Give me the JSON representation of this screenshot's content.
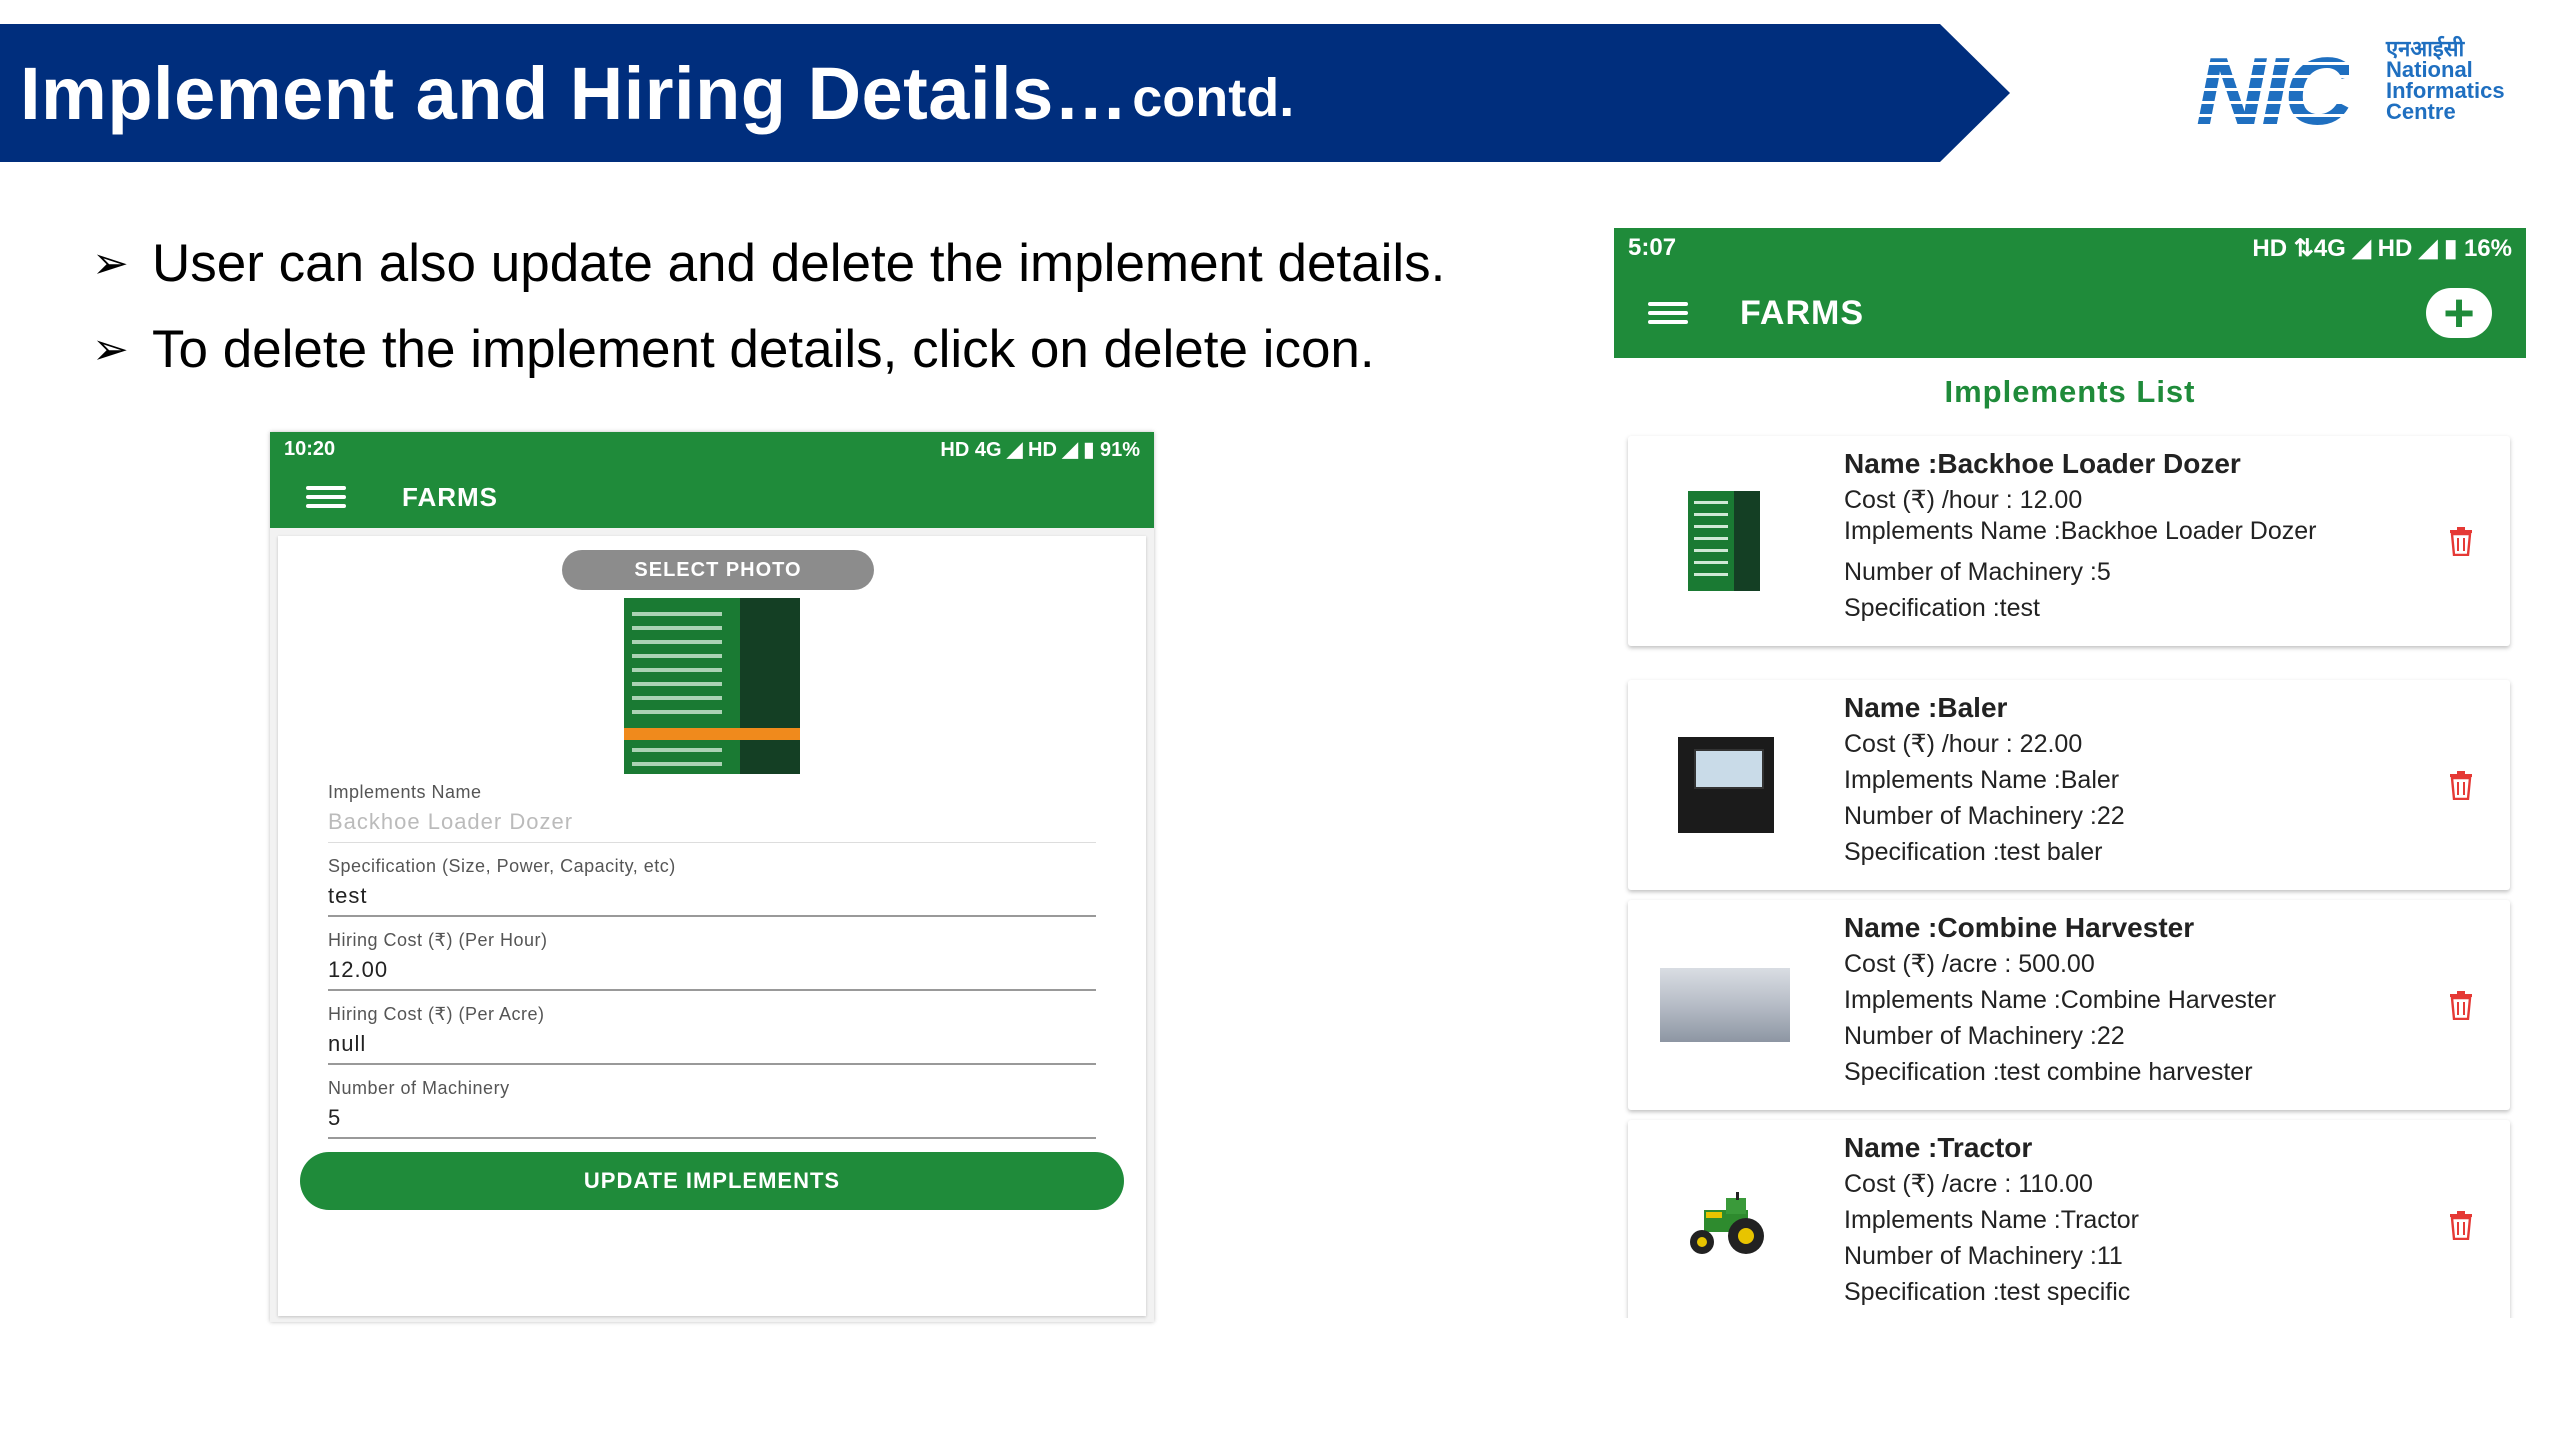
{
  "slide": {
    "title_main": "Implement and Hiring Details…",
    "title_suffix": "contd.",
    "logo": {
      "letters": "NIC",
      "hindi": "एनआईसी",
      "line1": "National",
      "line2": "Informatics",
      "line3": "Centre"
    },
    "bullets": [
      "User can also update and delete the implement details.",
      "To delete the implement details, click on delete icon."
    ],
    "bullet_symbol": "➢"
  },
  "left_phone": {
    "status_time": "10:20",
    "status_right": "HD 4G ◢ HD ◢ ▮ 91%",
    "app_title": "FARMS",
    "select_photo": "SELECT PHOTO",
    "fields": [
      {
        "label": "Implements Name",
        "value": "Backhoe Loader Dozer"
      },
      {
        "label": "Specification (Size, Power, Capacity, etc)",
        "value": "test"
      },
      {
        "label": "Hiring Cost (₹) (Per Hour)",
        "value": "12.00"
      },
      {
        "label": "Hiring Cost (₹) (Per Acre)",
        "value": "null"
      },
      {
        "label": "Number of Machinery",
        "value": "5"
      }
    ],
    "update_button": "UPDATE IMPLEMENTS"
  },
  "right_phone": {
    "status_time": "5:07",
    "status_right": "HD ⇅4G ◢ HD ◢ ▮ 16%",
    "app_title": "FARMS",
    "add_icon": "+",
    "list_title": "Implements List",
    "items": [
      {
        "name": "Name  :Backhoe Loader Dozer",
        "cost": "Cost (₹) /hour : 12.00",
        "implements_name": "Implements Name  :Backhoe Loader Dozer",
        "machinery": "Number of Machinery :5",
        "specification": "Specification  :test"
      },
      {
        "name": "Name  :Baler",
        "cost": "Cost (₹) /hour : 22.00",
        "implements_name": "Implements Name  :Baler",
        "machinery": "Number of Machinery :22",
        "specification": "Specification  :test baler"
      },
      {
        "name": "Name  :Combine Harvester",
        "cost": "Cost (₹) /acre : 500.00",
        "implements_name": "Implements Name  :Combine Harvester",
        "machinery": "Number of Machinery :22",
        "specification": "Specification  :test combine harvester"
      },
      {
        "name": "Name  :Tractor",
        "cost": "Cost (₹) /acre : 110.00",
        "implements_name": "Implements Name  :Tractor",
        "machinery": "Number of Machinery :11",
        "specification": "Specification  :test specific"
      }
    ]
  },
  "colors": {
    "banner": "#002e7d",
    "app_green": "#1f8b3a",
    "delete_red": "#e53935",
    "nic_blue": "#1f6fc0"
  }
}
